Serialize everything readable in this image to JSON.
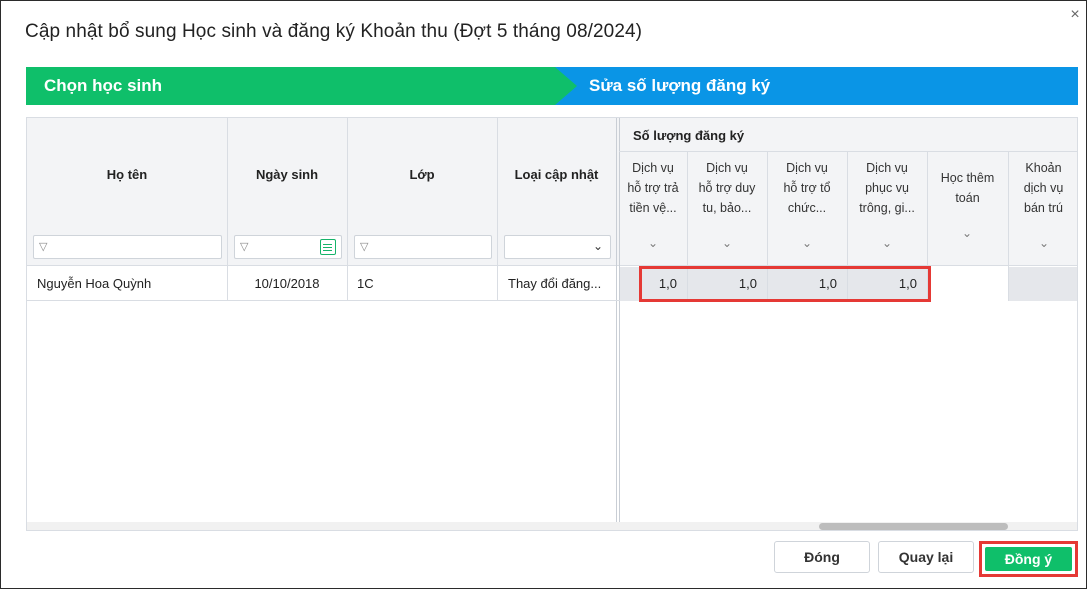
{
  "dialog": {
    "title": "Cập nhật bổ sung Học sinh và đăng ký Khoản thu (Đợt 5 tháng 08/2024)",
    "close_glyph": "×"
  },
  "steps": [
    {
      "label": "Chọn học sinh",
      "color": "#0fbf6a"
    },
    {
      "label": "Sửa số lượng đăng ký",
      "color": "#0a95e6"
    }
  ],
  "table": {
    "columns": {
      "name": "Họ tên",
      "dob": "Ngày sinh",
      "class": "Lớp",
      "update_type": "Loại cập nhật"
    },
    "group_header": "Số lượng đăng ký",
    "sub_columns": [
      {
        "line1": "Dịch vụ",
        "line2": "hỗ trợ trả",
        "line3": "tiền vệ..."
      },
      {
        "line1": "Dịch vụ",
        "line2": "hỗ trợ duy",
        "line3": "tu, bảo..."
      },
      {
        "line1": "Dịch vụ",
        "line2": "hỗ trợ tổ",
        "line3": "chức..."
      },
      {
        "line1": "Dịch vụ",
        "line2": "phục vụ",
        "line3": "trông, gi..."
      },
      {
        "line1": "Học thêm",
        "line2": "toán",
        "line3": ""
      },
      {
        "line1": "Khoản",
        "line2": "dịch vụ",
        "line3": "bán trú"
      }
    ],
    "rows": [
      {
        "name": "Nguyễn Hoa Quỳnh",
        "dob": "10/10/2018",
        "class": "1C",
        "update_type": "Thay đổi đăng...",
        "quantities": [
          "1,0",
          "1,0",
          "1,0",
          "1,0",
          "",
          ""
        ]
      }
    ]
  },
  "buttons": {
    "close": "Đóng",
    "back": "Quay lại",
    "confirm": "Đồng ý"
  },
  "colors": {
    "primary_green": "#0fbf6a",
    "step_blue": "#0a95e6",
    "highlight_red": "#e53935"
  }
}
